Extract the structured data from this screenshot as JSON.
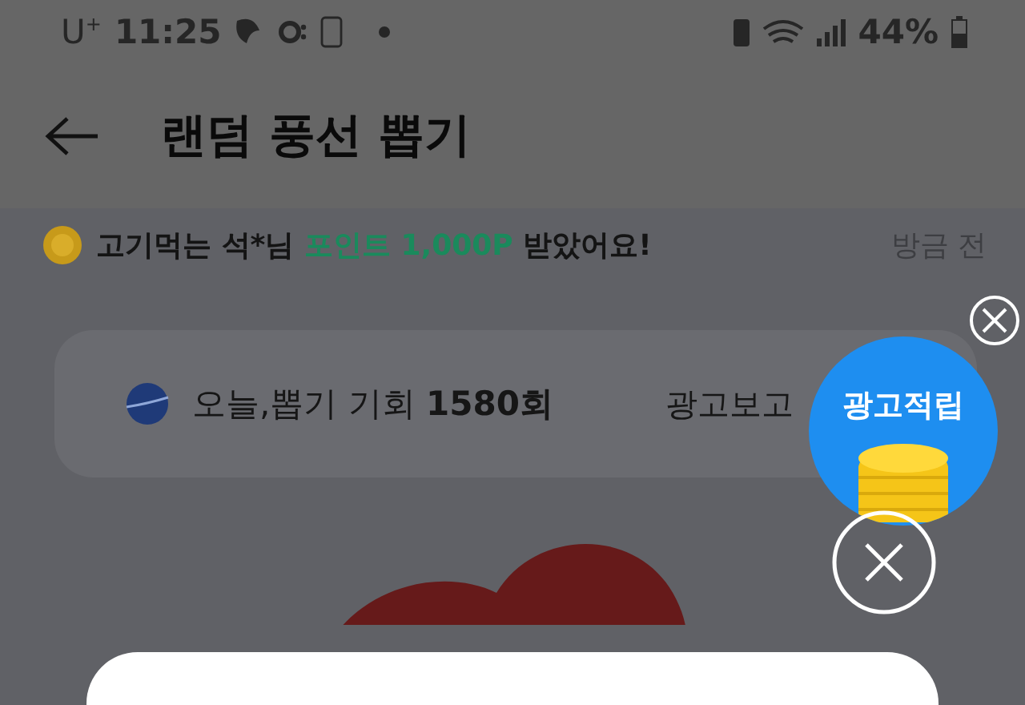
{
  "status_bar": {
    "carrier": "U$^{+}$",
    "time": "11:25",
    "battery": "44%"
  },
  "header": {
    "title": "랜덤 풍선 뽑기"
  },
  "notice": {
    "message": "고기먹는 석*님 **포인트 1,000P** 받았어요!",
    "time": "방금 전"
  },
  "chance_card": {
    "text": "오늘,뽑기 기회 **1580회**",
    "ad_link": "광고보고"
  },
  "ad_badge": {
    "label": "광고적립"
  }
}
